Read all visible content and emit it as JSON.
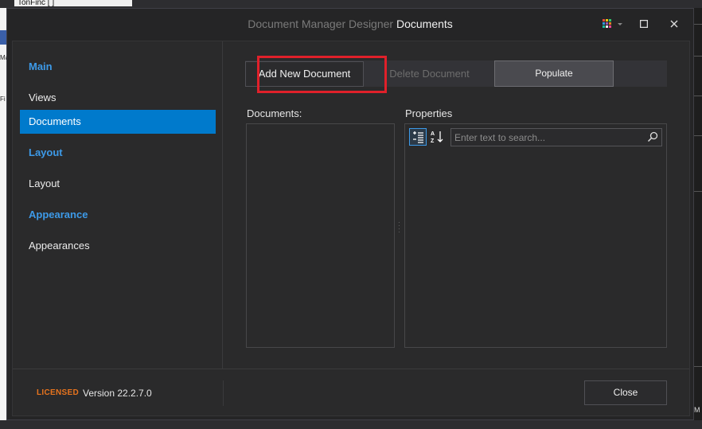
{
  "background": {
    "tab_title": "TonFinc [ ] ",
    "left_labels": [
      "Ma",
      "Fi"
    ],
    "right_labels": [
      "M"
    ]
  },
  "dialog": {
    "title_muted": "Document Manager Designer",
    "title_strong": "Documents",
    "window_buttons": {
      "palette": "palette-icon",
      "maximize": "□",
      "close": "✕"
    }
  },
  "sidebar": {
    "groups": [
      {
        "header": "Main",
        "items": [
          {
            "label": "Views",
            "active": false
          },
          {
            "label": "Documents",
            "active": true
          }
        ]
      },
      {
        "header": "Layout",
        "items": [
          {
            "label": "Layout",
            "active": false
          }
        ]
      },
      {
        "header": "Appearance",
        "items": [
          {
            "label": "Appearances",
            "active": false
          }
        ]
      }
    ]
  },
  "toolbar": {
    "add_label": "Add New Document",
    "delete_label": "Delete Document",
    "populate_label": "Populate"
  },
  "documents": {
    "label": "Documents:"
  },
  "properties": {
    "label": "Properties",
    "search_placeholder": "Enter text to search...",
    "categorized_icon": "categorized-icon",
    "alphabetical_icon": "sort-az-icon"
  },
  "footer": {
    "licensed": "LICENSED",
    "version": "Version 22.2.7.0",
    "close_label": "Close"
  },
  "colors": {
    "accent": "#007acc",
    "group_header": "#3d9ae8",
    "licensed": "#e8741e",
    "highlight": "#e0202a"
  }
}
